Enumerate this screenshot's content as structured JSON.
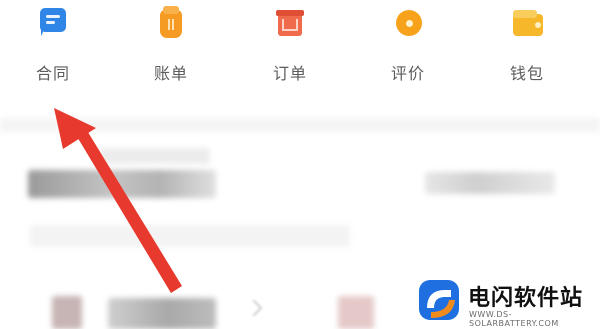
{
  "menu": {
    "items": [
      {
        "label": "合同",
        "icon": "contract-icon",
        "color": "#2f86e6"
      },
      {
        "label": "账单",
        "icon": "bill-icon",
        "color": "#f59a23"
      },
      {
        "label": "订单",
        "icon": "order-icon",
        "color": "#f06a4c"
      },
      {
        "label": "评价",
        "icon": "review-icon",
        "color": "#f7a21b"
      },
      {
        "label": "钱包",
        "icon": "wallet-icon",
        "color": "#f6b72a"
      }
    ]
  },
  "annotation": {
    "arrow_color": "#e8392e",
    "points_to": "合同"
  },
  "watermark": {
    "title": "电闪软件站",
    "url": "WWW.DS-SOLARBATTERY.COM",
    "logo_colors": [
      "#1f6fe0",
      "#f28b1d"
    ]
  }
}
